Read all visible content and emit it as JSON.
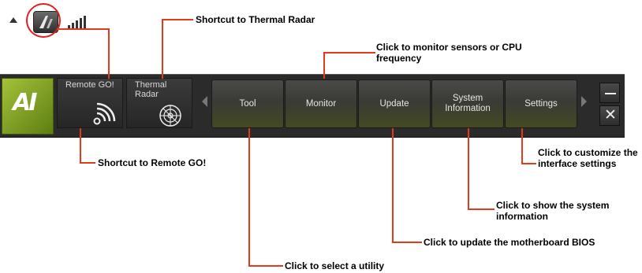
{
  "tray": {
    "arrow_icon": "up-arrow-icon",
    "app_icon": "ai-suite-icon",
    "signal_icon": "signal-strength-icon"
  },
  "dock": {
    "logo_text": "AI",
    "quick_launch": [
      {
        "label": "Remote GO!",
        "icon": "wireless-icon"
      },
      {
        "label": "Thermal Radar",
        "icon": "radar-icon"
      }
    ],
    "tabs": [
      "Tool",
      "Monitor",
      "Update",
      "System Information",
      "Settings"
    ],
    "minimize_icon": "minimize-icon",
    "close_icon": "close-icon",
    "accent_color": "#8aab1e"
  },
  "annotations": {
    "thermal_radar": "Shortcut to Thermal Radar",
    "monitor": "Click to monitor sensors or CPU frequency",
    "remote_go": "Shortcut to Remote GO!",
    "settings": "Click to customize the interface settings",
    "system_info": "Click to show the system information",
    "update": "Click to update the motherboard BIOS",
    "tool": "Click to select a utility"
  }
}
